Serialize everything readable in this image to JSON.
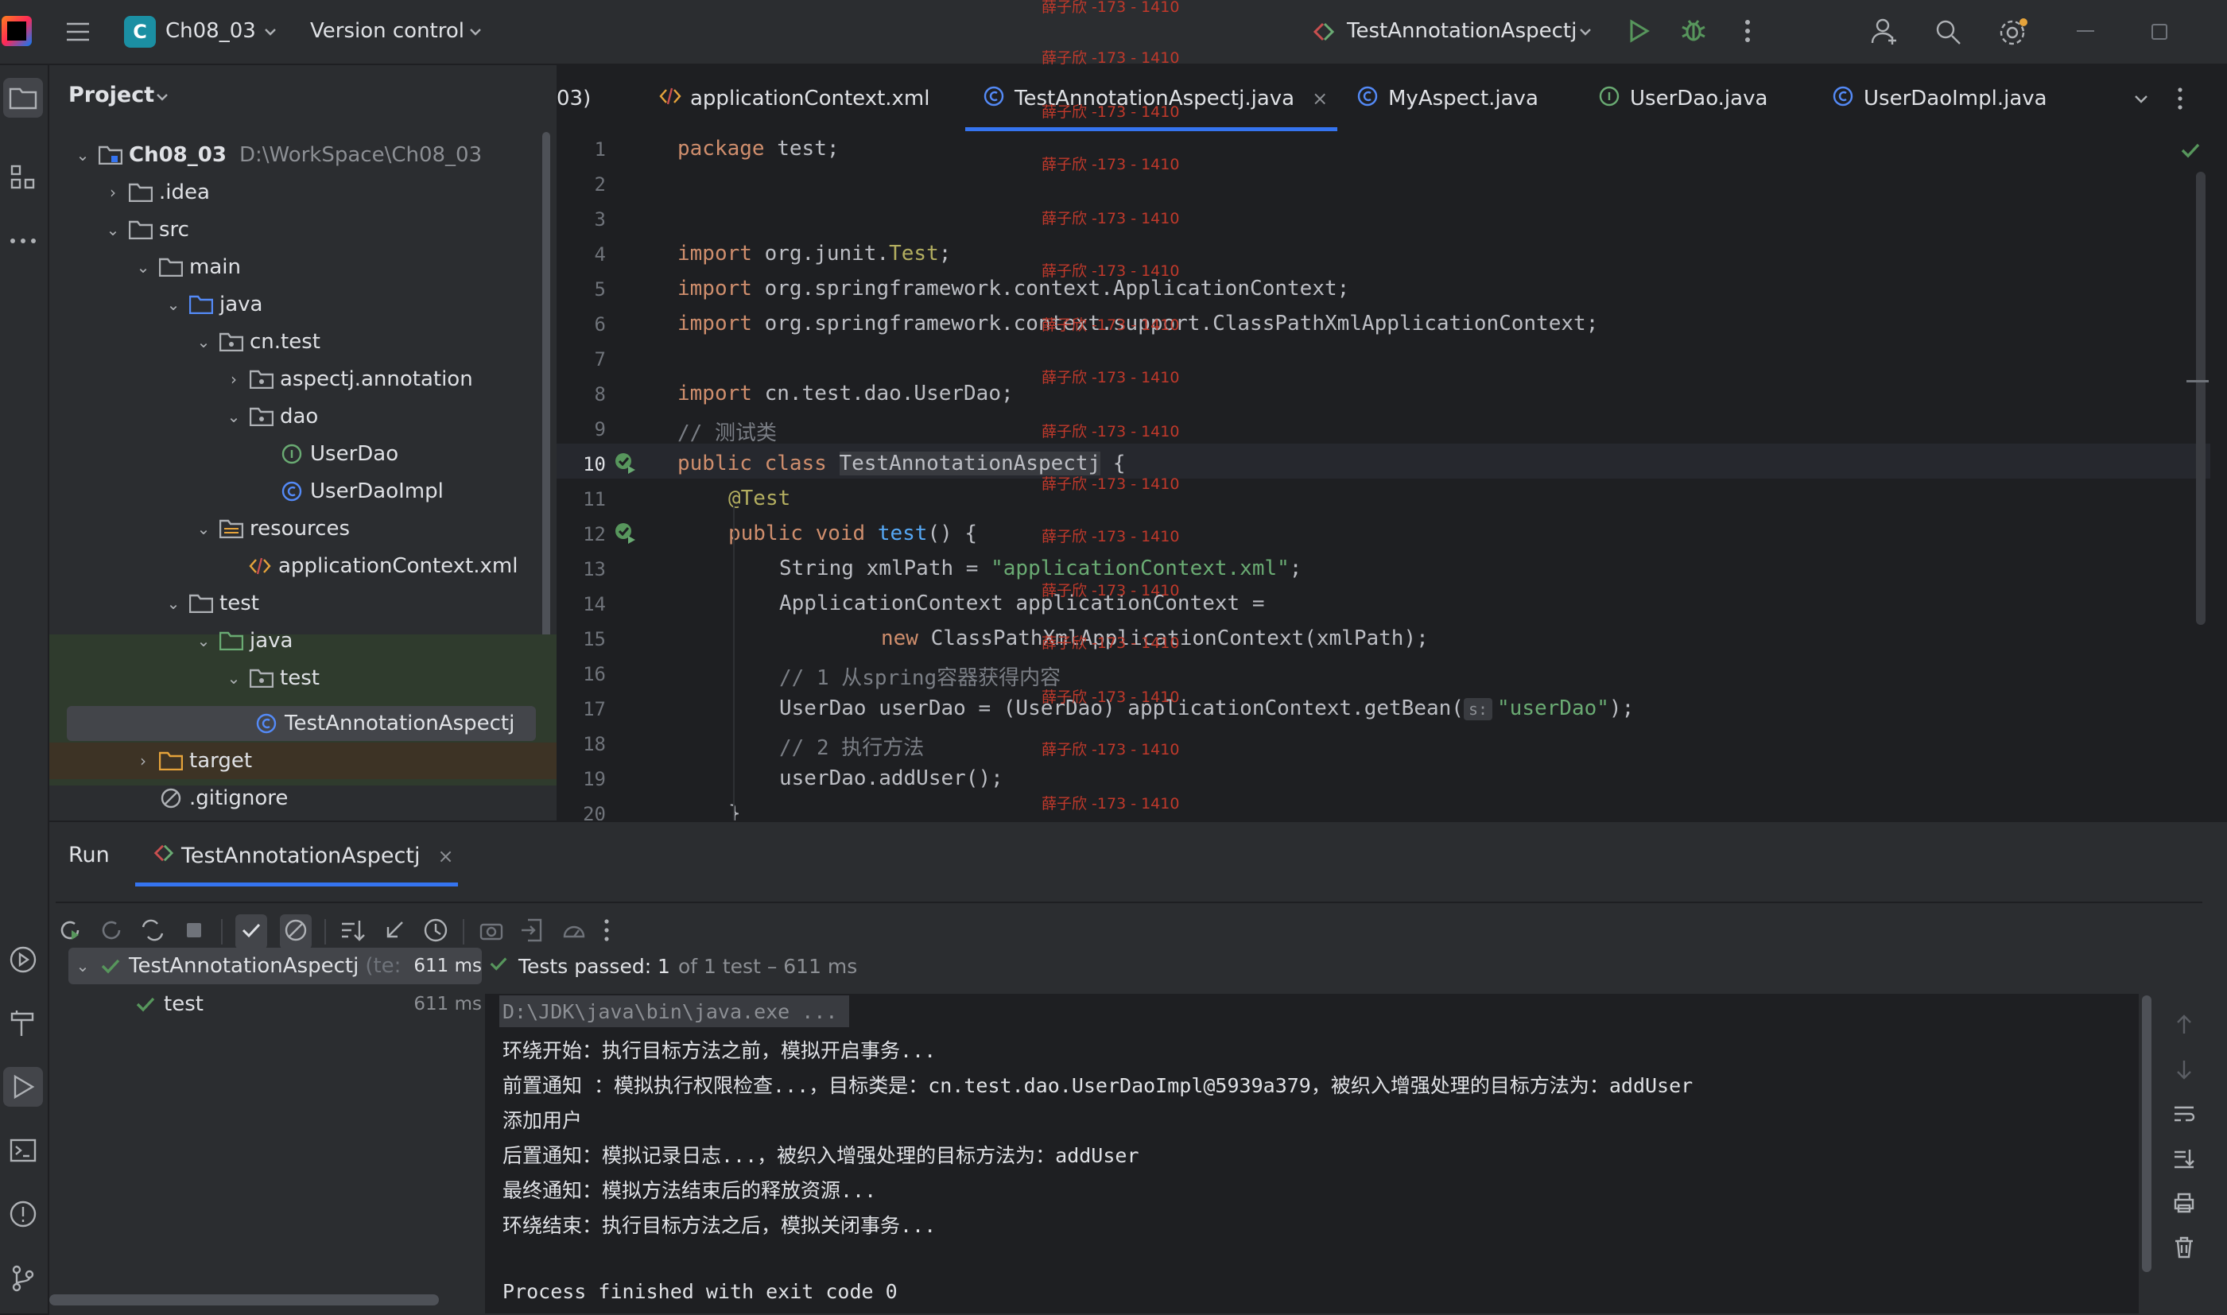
{
  "titlebar": {
    "project_badge": "C",
    "project_name": "Ch08_03",
    "vcs_menu": "Version control",
    "run_config": "TestAnnotationAspectj"
  },
  "project_panel": {
    "title": "Project",
    "tree": [
      {
        "label": "Ch08_03",
        "path": "D:\\WorkSpace\\Ch08_03"
      },
      {
        "label": ".idea"
      },
      {
        "label": "src"
      },
      {
        "label": "main"
      },
      {
        "label": "java"
      },
      {
        "label": "cn.test"
      },
      {
        "label": "aspectj.annotation"
      },
      {
        "label": "dao"
      },
      {
        "label": "UserDao"
      },
      {
        "label": "UserDaoImpl"
      },
      {
        "label": "resources"
      },
      {
        "label": "applicationContext.xml"
      },
      {
        "label": "test"
      },
      {
        "label": "java"
      },
      {
        "label": "test"
      },
      {
        "label": "TestAnnotationAspectj"
      },
      {
        "label": "target"
      },
      {
        "label": ".gitignore"
      }
    ]
  },
  "editor": {
    "tabs": [
      {
        "label": "03)"
      },
      {
        "label": "applicationContext.xml"
      },
      {
        "label": "TestAnnotationAspectj.java"
      },
      {
        "label": "MyAspect.java"
      },
      {
        "label": "UserDao.java"
      },
      {
        "label": "UserDaoImpl.java"
      }
    ],
    "line_numbers": [
      "1",
      "2",
      "3",
      "4",
      "5",
      "6",
      "7",
      "8",
      "9",
      "10",
      "11",
      "12",
      "13",
      "14",
      "15",
      "16",
      "17",
      "18",
      "19",
      "20"
    ],
    "code": {
      "l1_kw": "package",
      "l1_rest": " test;",
      "l4_kw": "import",
      "l4_a": " org.junit.",
      "l4_b": "Test",
      "l4_c": ";",
      "l5_kw": "import",
      "l5_rest": " org.springframework.context.ApplicationContext;",
      "l6_kw": "import",
      "l6_rest": " org.springframework.context.support.ClassPathXmlApplicationContext;",
      "l8_kw": "import",
      "l8_rest": " cn.test.dao.UserDao;",
      "l9": "// 测试类",
      "l10_kw": "public class",
      "l10_cls": "TestAnnotationAspectj",
      "l10_rest": " {",
      "l11": "@Test",
      "l12_kw": "public void",
      "l12_fn": "test",
      "l12_rest": "() {",
      "l13_a": "String xmlPath = ",
      "l13_str": "\"applicationContext.xml\"",
      "l13_c": ";",
      "l14": "ApplicationContext applicationContext =",
      "l15_kw": "new",
      "l15_rest": " ClassPathXmlApplicationContext(xmlPath);",
      "l16": "// 1 从spring容器获得内容",
      "l17_a": "UserDao userDao = (UserDao) applicationContext.getBean(",
      "l17_hint": "s:",
      "l17_str": "\"userDao\"",
      "l17_c": ");",
      "l18": "// 2 执行方法",
      "l19": "userDao.addUser();",
      "l20": "}"
    }
  },
  "watermark": "薛子欣 -173 - 1410",
  "run_panel": {
    "title": "Run",
    "tab_label": "TestAnnotationAspectj",
    "tests": [
      {
        "name": "TestAnnotationAspectj",
        "suffix": "(te:",
        "time": "611 ms"
      },
      {
        "name": "test",
        "time": "611 ms"
      }
    ],
    "status_bold": "Tests passed: 1",
    "status_rest": "of 1 test – 611 ms",
    "console": [
      "D:\\JDK\\java\\bin\\java.exe ...",
      "环绕开始：执行目标方法之前，模拟开启事务...",
      "前置通知 ：模拟执行权限检查...，目标类是：cn.test.dao.UserDaoImpl@5939a379，被织入增强处理的目标方法为：addUser",
      "添加用户",
      "后置通知：模拟记录日志...，被织入增强处理的目标方法为：addUser",
      "最终通知：模拟方法结束后的释放资源...",
      "环绕结束：执行目标方法之后，模拟关闭事务...",
      "",
      "Process finished with exit code 0"
    ]
  }
}
